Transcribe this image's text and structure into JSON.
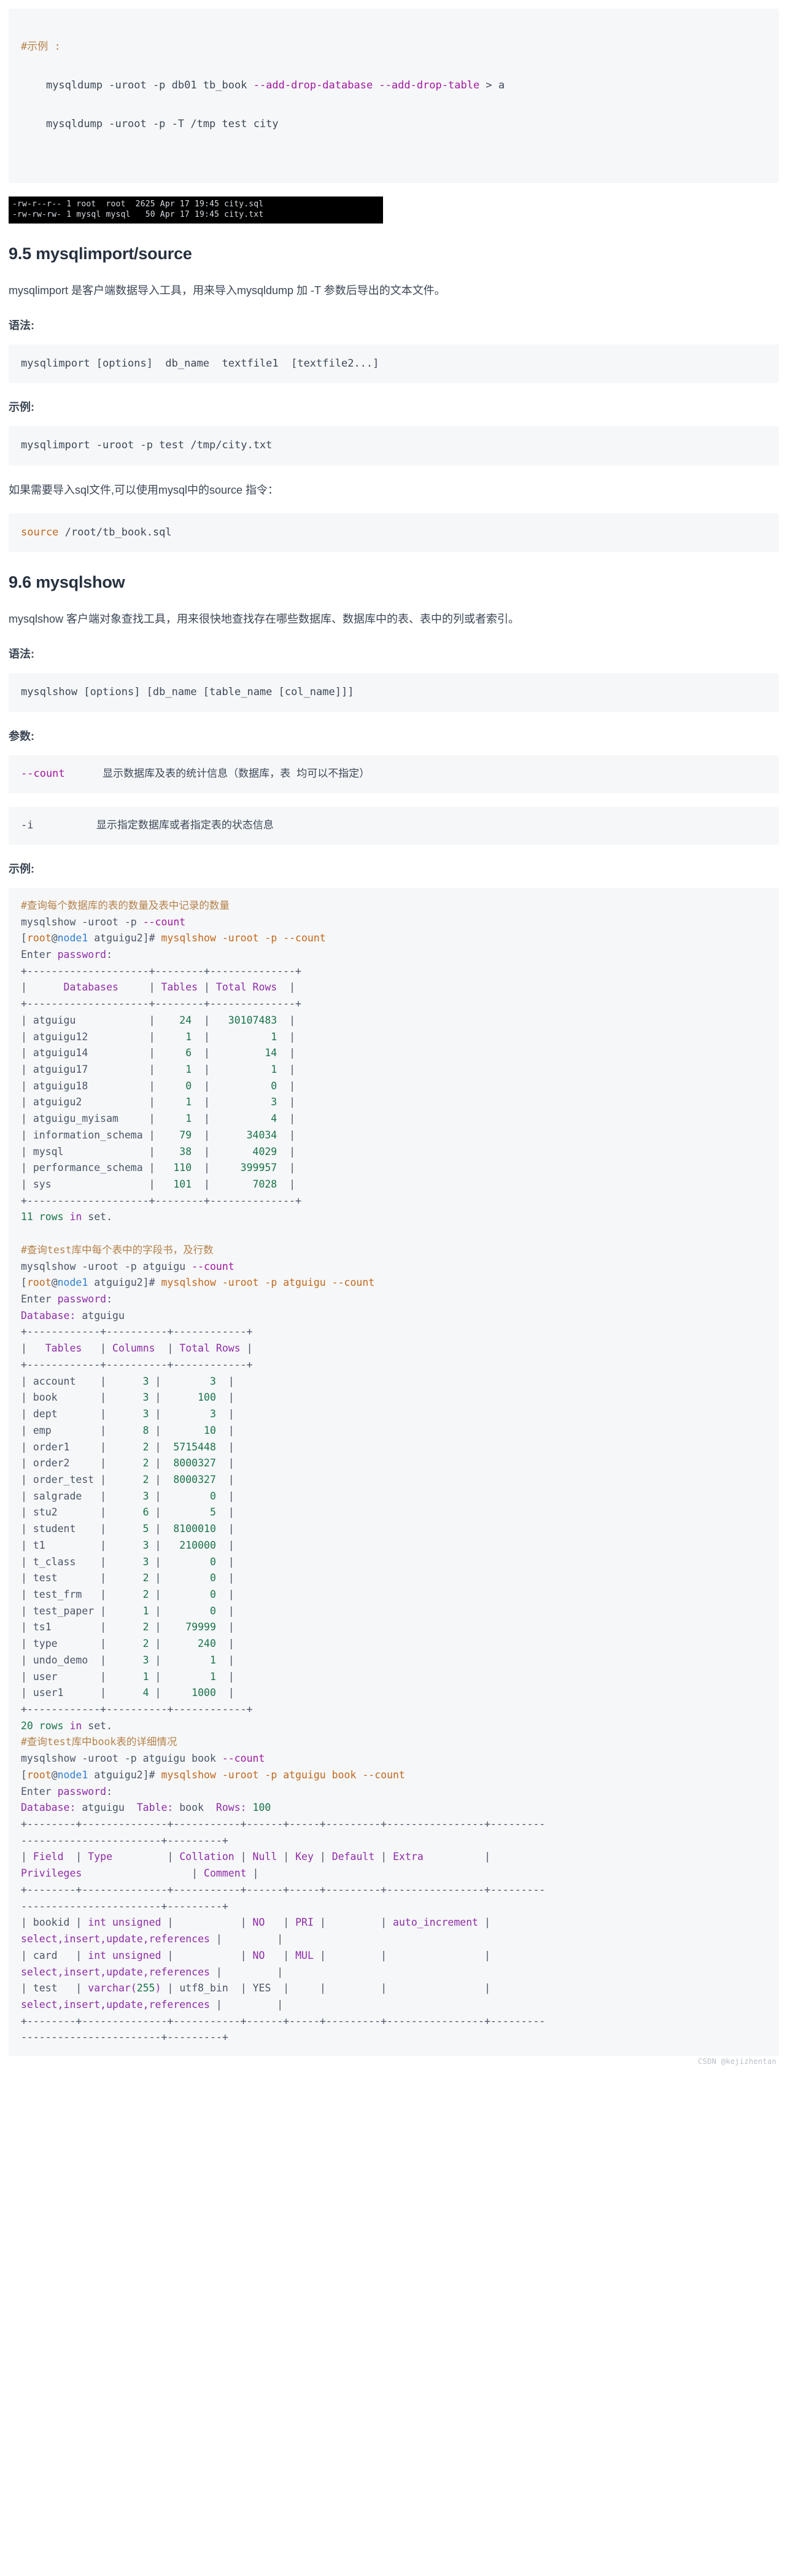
{
  "blocks": {
    "top_example_code": [
      {
        "text": "#示例 :",
        "cls": "c-cmt"
      },
      {
        "text": "",
        "cls": "c-plain"
      },
      {
        "text": "    mysqldump -uroot -p db01 tb_book ",
        "cls": "c-plain",
        "runs": [
          {
            "t": "    mysqldump -uroot -p db01 tb_book ",
            "c": "c-plain"
          },
          {
            "t": "--add-drop-database --add-drop-table",
            "c": "c-opt"
          },
          {
            "t": " > a",
            "c": "c-plain"
          }
        ]
      },
      {
        "text": "",
        "cls": "c-plain"
      },
      {
        "text": "    mysqldump -uroot -p -T /tmp test city",
        "cls": "c-plain"
      }
    ],
    "terminal_lines": [
      "-rw-r--r-- 1 root  root  2625 Apr 17 19:45 city.sql",
      "-rw-rw-rw- 1 mysql mysql   50 Apr 17 19:45 city.txt"
    ],
    "section_95_title": "9.5 mysqlimport/source",
    "section_95_intro": "mysqlimport 是客户端数据导入工具，用来导入mysqldump 加 -T 参数后导出的文本文件。",
    "label_syntax": "语法:",
    "syntax_95": "mysqlimport [options]  db_name  textfile1  [textfile2...]",
    "label_example": "示例:",
    "example_95": "mysqlimport -uroot -p test /tmp/city.txt",
    "source_note": "如果需要导入sql文件,可以使用mysql中的source 指令：",
    "source_cmd_kw": "source",
    "source_cmd_rest": " /root/tb_book.sql",
    "section_96_title": "9.6 mysqlshow",
    "section_96_intro": "mysqlshow 客户端对象查找工具，用来很快地查找存在哪些数据库、数据库中的表、表中的列或者索引。",
    "syntax_96": "mysqlshow [options] [db_name [table_name [col_name]]]",
    "label_params": "参数:",
    "params": [
      {
        "flag": "--count",
        "desc": "显示数据库及表的统计信息（数据库，表 均可以不指定）"
      },
      {
        "flag": "-i",
        "desc": "显示指定数据库或者指定表的状态信息"
      }
    ],
    "example1_comment": "#查询每个数据库的表的数量及表中记录的数量",
    "example1_cmd": "mysqlshow -uroot -p --count",
    "example1_prompt_user": "[root@node1",
    "example1_prompt_dir": " atguigu2]# ",
    "example1_prompt_cmd": "mysqlshow -uroot -p --count",
    "enter_password": "Enter password:",
    "db_table": {
      "rule": "+--------------------+--------+--------------+",
      "headers": [
        "Databases",
        "Tables",
        "Total Rows"
      ],
      "header_line": "|      Databases     | Tables | Total Rows  |",
      "rows": [
        {
          "name": "atguigu",
          "tables": "24",
          "rows": "30107483"
        },
        {
          "name": "atguigu12",
          "tables": "1",
          "rows": "1"
        },
        {
          "name": "atguigu14",
          "tables": "6",
          "rows": "14"
        },
        {
          "name": "atguigu17",
          "tables": "1",
          "rows": "1"
        },
        {
          "name": "atguigu18",
          "tables": "0",
          "rows": "0"
        },
        {
          "name": "atguigu2",
          "tables": "1",
          "rows": "3"
        },
        {
          "name": "atguigu_myisam",
          "tables": "1",
          "rows": "4"
        },
        {
          "name": "information_schema",
          "tables": "79",
          "rows": "34034"
        },
        {
          "name": "mysql",
          "tables": "38",
          "rows": "4029"
        },
        {
          "name": "performance_schema",
          "tables": "110",
          "rows": "399957"
        },
        {
          "name": "sys",
          "tables": "101",
          "rows": "7028"
        }
      ],
      "footer_count": "11 rows",
      "footer_suffix": " in set."
    },
    "example2_comment": "#查询test库中每个表中的字段书，及行数",
    "example2_cmd": "mysqlshow -uroot -p atguigu --count",
    "example2_prompt_cmd": "mysqlshow -uroot -p atguigu --count",
    "database_line_label": "Database:",
    "database_line_value": " atguigu",
    "tbl_table": {
      "rule": "+------------+----------+------------+",
      "header_line": "|   Tables   | Columns  | Total Rows |",
      "headers": [
        "Tables",
        "Columns",
        "Total Rows"
      ],
      "rows": [
        {
          "name": "account",
          "columns": "3",
          "rows": "3"
        },
        {
          "name": "book",
          "columns": "3",
          "rows": "100"
        },
        {
          "name": "dept",
          "columns": "3",
          "rows": "3"
        },
        {
          "name": "emp",
          "columns": "8",
          "rows": "10"
        },
        {
          "name": "order1",
          "columns": "2",
          "rows": "5715448"
        },
        {
          "name": "order2",
          "columns": "2",
          "rows": "8000327"
        },
        {
          "name": "order_test",
          "columns": "2",
          "rows": "8000327"
        },
        {
          "name": "salgrade",
          "columns": "3",
          "rows": "0"
        },
        {
          "name": "stu2",
          "columns": "6",
          "rows": "5"
        },
        {
          "name": "student",
          "columns": "5",
          "rows": "8100010"
        },
        {
          "name": "t1",
          "columns": "3",
          "rows": "210000"
        },
        {
          "name": "t_class",
          "columns": "3",
          "rows": "0"
        },
        {
          "name": "test",
          "columns": "2",
          "rows": "0"
        },
        {
          "name": "test_frm",
          "columns": "2",
          "rows": "0"
        },
        {
          "name": "test_paper",
          "columns": "1",
          "rows": "0"
        },
        {
          "name": "ts1",
          "columns": "2",
          "rows": "79999"
        },
        {
          "name": "type",
          "columns": "2",
          "rows": "240"
        },
        {
          "name": "undo_demo",
          "columns": "3",
          "rows": "1"
        },
        {
          "name": "user",
          "columns": "1",
          "rows": "1"
        },
        {
          "name": "user1",
          "columns": "4",
          "rows": "1000"
        }
      ],
      "footer_count": "20 rows",
      "footer_suffix": " in set."
    },
    "example3_comment": "#查询test库中book表的详细情况",
    "example3_cmd": "mysqlshow -uroot -p atguigu book --count",
    "example3_prompt_cmd": "mysqlshow -uroot -p atguigu book --count",
    "book_detail": {
      "db_label": "Database:",
      "db_value": " atguigu  ",
      "table_label": "Table:",
      "table_value": " book  ",
      "rows_label": "Rows:",
      "rows_value": " 100",
      "rule_a": "+--------+--------------+-----------+------+-----+---------+----------------+---------",
      "rule_b": "-----------------------+---------+",
      "header_a": "| Field  | Type         | Collation | Null | Key | Default | Extra          |",
      "header_b": "Privileges                  | Comment |",
      "fields": [
        {
          "line1_parts": [
            {
              "t": "| ",
              "c": "c-grey"
            },
            {
              "t": "bookid",
              "c": "c-grey"
            },
            {
              "t": " | ",
              "c": "c-grey"
            },
            {
              "t": "int unsigned",
              "c": "c-purple"
            },
            {
              "t": " |           | ",
              "c": "c-grey"
            },
            {
              "t": "NO",
              "c": "c-purple"
            },
            {
              "t": "   | ",
              "c": "c-grey"
            },
            {
              "t": "PRI",
              "c": "c-purple"
            },
            {
              "t": " |         | ",
              "c": "c-grey"
            },
            {
              "t": "auto_increment",
              "c": "c-purple"
            },
            {
              "t": " |",
              "c": "c-grey"
            }
          ],
          "line2_parts": [
            {
              "t": "select,insert,update,references",
              "c": "c-purple"
            },
            {
              "t": " |         |",
              "c": "c-grey"
            }
          ]
        },
        {
          "line1_parts": [
            {
              "t": "| ",
              "c": "c-grey"
            },
            {
              "t": "card",
              "c": "c-grey"
            },
            {
              "t": "   | ",
              "c": "c-grey"
            },
            {
              "t": "int unsigned",
              "c": "c-purple"
            },
            {
              "t": " |           | ",
              "c": "c-grey"
            },
            {
              "t": "NO",
              "c": "c-purple"
            },
            {
              "t": "   | ",
              "c": "c-grey"
            },
            {
              "t": "MUL",
              "c": "c-purple"
            },
            {
              "t": " |         |                | ",
              "c": "c-grey"
            }
          ],
          "line2_parts": [
            {
              "t": "select,insert,update,references",
              "c": "c-purple"
            },
            {
              "t": " |         |",
              "c": "c-grey"
            }
          ]
        },
        {
          "line1_parts": [
            {
              "t": "| ",
              "c": "c-grey"
            },
            {
              "t": "test",
              "c": "c-grey"
            },
            {
              "t": "   | ",
              "c": "c-grey"
            },
            {
              "t": "varchar(",
              "c": "c-purple"
            },
            {
              "t": "255",
              "c": "c-green"
            },
            {
              "t": ")",
              "c": "c-purple"
            },
            {
              "t": " | ",
              "c": "c-grey"
            },
            {
              "t": "utf8_bin",
              "c": "c-grey"
            },
            {
              "t": "  | ",
              "c": "c-grey"
            },
            {
              "t": "YES",
              "c": "c-grey"
            },
            {
              "t": "  |     |         |                | ",
              "c": "c-grey"
            }
          ],
          "line2_parts": [
            {
              "t": "select,insert,update,references",
              "c": "c-purple"
            },
            {
              "t": " |         |",
              "c": "c-grey"
            }
          ]
        }
      ]
    },
    "watermark": "CSDN @kejizhentan"
  }
}
